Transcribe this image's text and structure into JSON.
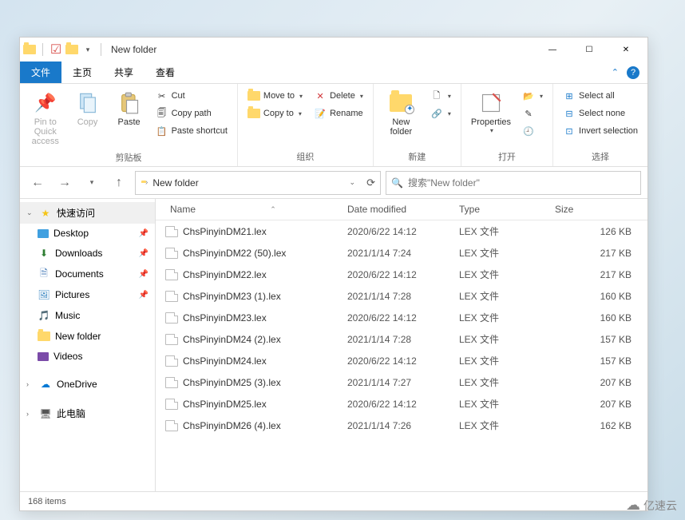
{
  "window": {
    "title": "New folder"
  },
  "win_controls": {
    "min": "—",
    "max": "☐",
    "close": "✕"
  },
  "menu": {
    "file": "文件",
    "home": "主页",
    "share": "共享",
    "view": "查看"
  },
  "ribbon": {
    "pin": "Pin to Quick access",
    "copy": "Copy",
    "paste": "Paste",
    "cut": "Cut",
    "copy_path": "Copy path",
    "paste_shortcut": "Paste shortcut",
    "clipboard_group": "剪贴板",
    "move_to": "Move to",
    "copy_to": "Copy to",
    "delete": "Delete",
    "rename": "Rename",
    "organize_group": "组织",
    "new_folder": "New folder",
    "new_item": "",
    "easy_access": "",
    "new_group": "新建",
    "properties": "Properties",
    "open": "",
    "edit": "",
    "history": "",
    "open_group": "打开",
    "select_all": "Select all",
    "select_none": "Select none",
    "invert_selection": "Invert selection",
    "select_group": "选择"
  },
  "nav": {
    "back": "←",
    "forward": "→",
    "up": "↑"
  },
  "address": {
    "text": "New folder"
  },
  "search": {
    "placeholder": "搜索\"New folder\""
  },
  "sidebar": {
    "quick_access": "快速访问",
    "desktop": "Desktop",
    "downloads": "Downloads",
    "documents": "Documents",
    "pictures": "Pictures",
    "music": "Music",
    "new_folder": "New folder",
    "videos": "Videos",
    "onedrive": "OneDrive",
    "this_pc": "此电脑"
  },
  "headers": {
    "name": "Name",
    "date": "Date modified",
    "type": "Type",
    "size": "Size"
  },
  "files": [
    {
      "name": "ChsPinyinDM21.lex",
      "date": "2020/6/22 14:12",
      "type": "LEX 文件",
      "size": "126 KB"
    },
    {
      "name": "ChsPinyinDM22 (50).lex",
      "date": "2021/1/14 7:24",
      "type": "LEX 文件",
      "size": "217 KB"
    },
    {
      "name": "ChsPinyinDM22.lex",
      "date": "2020/6/22 14:12",
      "type": "LEX 文件",
      "size": "217 KB"
    },
    {
      "name": "ChsPinyinDM23 (1).lex",
      "date": "2021/1/14 7:28",
      "type": "LEX 文件",
      "size": "160 KB"
    },
    {
      "name": "ChsPinyinDM23.lex",
      "date": "2020/6/22 14:12",
      "type": "LEX 文件",
      "size": "160 KB"
    },
    {
      "name": "ChsPinyinDM24 (2).lex",
      "date": "2021/1/14 7:28",
      "type": "LEX 文件",
      "size": "157 KB"
    },
    {
      "name": "ChsPinyinDM24.lex",
      "date": "2020/6/22 14:12",
      "type": "LEX 文件",
      "size": "157 KB"
    },
    {
      "name": "ChsPinyinDM25 (3).lex",
      "date": "2021/1/14 7:27",
      "type": "LEX 文件",
      "size": "207 KB"
    },
    {
      "name": "ChsPinyinDM25.lex",
      "date": "2020/6/22 14:12",
      "type": "LEX 文件",
      "size": "207 KB"
    },
    {
      "name": "ChsPinyinDM26 (4).lex",
      "date": "2021/1/14 7:26",
      "type": "LEX 文件",
      "size": "162 KB"
    }
  ],
  "status": {
    "items": "168 items"
  },
  "watermark": "亿速云"
}
